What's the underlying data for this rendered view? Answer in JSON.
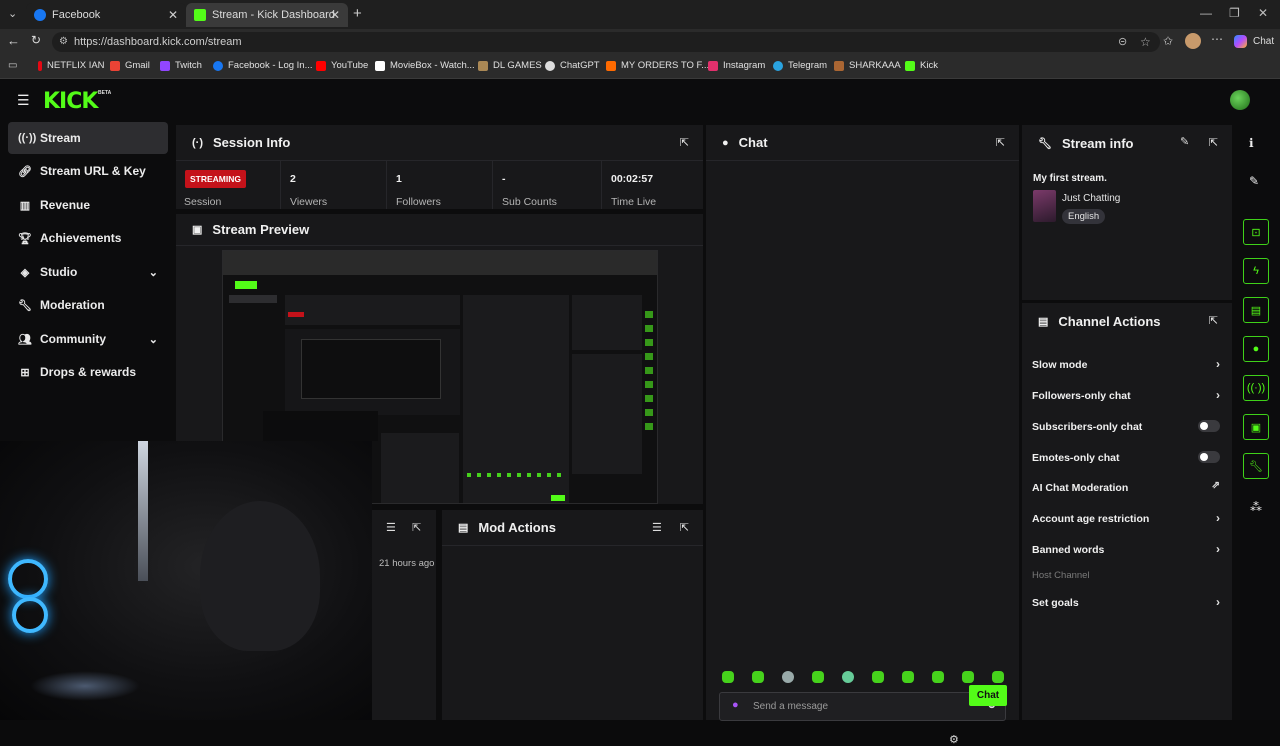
{
  "browser": {
    "tabs": [
      {
        "label": "Facebook",
        "active": false
      },
      {
        "label": "Stream - Kick Dashboard",
        "active": true
      }
    ],
    "url": "https://dashboard.kick.com/stream",
    "chat_label": "Chat",
    "bookmarks": [
      {
        "label": "NETFLIX IAN",
        "color": "#e50914"
      },
      {
        "label": "Gmail",
        "color": "#ea4335"
      },
      {
        "label": "Twitch",
        "color": "#9146ff"
      },
      {
        "label": "Facebook - Log In...",
        "color": "#1877f2"
      },
      {
        "label": "YouTube",
        "color": "#ff0000"
      },
      {
        "label": "MovieBox - Watch...",
        "color": "#ffffff"
      },
      {
        "label": "DL GAMES",
        "color": "#aa8855"
      },
      {
        "label": "ChatGPT",
        "color": "#dddddd"
      },
      {
        "label": "MY ORDERS TO F...",
        "color": "#ff6a00"
      },
      {
        "label": "Instagram",
        "color": "#e1306c"
      },
      {
        "label": "Telegram",
        "color": "#2aa3e0"
      },
      {
        "label": "SHARKAAA",
        "color": "#aa6633"
      },
      {
        "label": "Kick",
        "color": "#53fc18"
      }
    ]
  },
  "brand": {
    "logo": "KICK",
    "badge": "BETA",
    "accent": "#53fc18"
  },
  "sidebar": {
    "items": [
      {
        "label": "Stream",
        "icon": "stream-icon",
        "active": true
      },
      {
        "label": "Stream URL & Key",
        "icon": "link-icon"
      },
      {
        "label": "Revenue",
        "icon": "chart-icon"
      },
      {
        "label": "Achievements",
        "icon": "trophy-icon"
      },
      {
        "label": "Studio",
        "icon": "studio-icon",
        "expandable": true
      },
      {
        "label": "Moderation",
        "icon": "wrench-icon"
      },
      {
        "label": "Community",
        "icon": "people-icon",
        "expandable": true
      },
      {
        "label": "Drops & rewards",
        "icon": "gift-icon"
      }
    ]
  },
  "session": {
    "title": "Session Info",
    "status": "STREAMING",
    "status_label": "Session",
    "stats": [
      {
        "value": "2",
        "label": "Viewers"
      },
      {
        "value": "1",
        "label": "Followers"
      },
      {
        "value": "-",
        "label": "Sub Counts"
      },
      {
        "value": "00:02:57",
        "label": "Time Live"
      }
    ]
  },
  "preview": {
    "title": "Stream Preview"
  },
  "activity": {
    "time": "21 hours ago"
  },
  "mod_actions": {
    "title": "Mod Actions"
  },
  "chat": {
    "title": "Chat",
    "placeholder": "Send a message",
    "send": "Chat"
  },
  "stream_info": {
    "title": "Stream info",
    "stream_title": "My first stream.",
    "category": "Just Chatting",
    "language": "English"
  },
  "channel_actions": {
    "title": "Channel Actions",
    "rows": [
      {
        "label": "Slow mode",
        "control": "arrow"
      },
      {
        "label": "Followers-only chat",
        "control": "arrow"
      },
      {
        "label": "Subscribers-only chat",
        "control": "toggle"
      },
      {
        "label": "Emotes-only chat",
        "control": "toggle"
      },
      {
        "label": "AI Chat Moderation",
        "control": "external"
      },
      {
        "label": "Account age restriction",
        "control": "arrow"
      },
      {
        "label": "Banned words",
        "control": "arrow"
      },
      {
        "label": "Host Channel",
        "control": "none",
        "disabled": true
      },
      {
        "label": "Set goals",
        "control": "arrow"
      }
    ]
  }
}
